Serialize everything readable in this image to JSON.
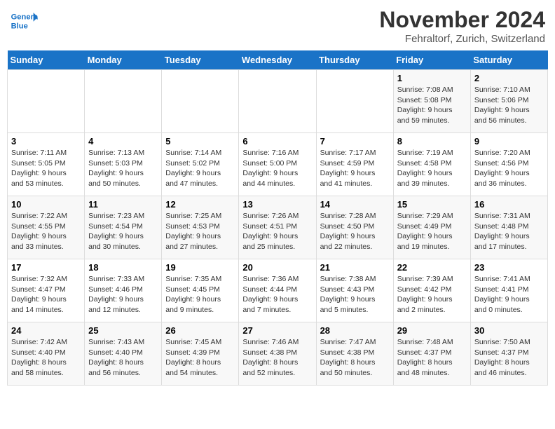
{
  "header": {
    "logo_line1": "General",
    "logo_line2": "Blue",
    "main_title": "November 2024",
    "subtitle": "Fehraltorf, Zurich, Switzerland"
  },
  "days_of_week": [
    "Sunday",
    "Monday",
    "Tuesday",
    "Wednesday",
    "Thursday",
    "Friday",
    "Saturday"
  ],
  "weeks": [
    [
      {
        "day": "",
        "info": ""
      },
      {
        "day": "",
        "info": ""
      },
      {
        "day": "",
        "info": ""
      },
      {
        "day": "",
        "info": ""
      },
      {
        "day": "",
        "info": ""
      },
      {
        "day": "1",
        "info": "Sunrise: 7:08 AM\nSunset: 5:08 PM\nDaylight: 9 hours and 59 minutes."
      },
      {
        "day": "2",
        "info": "Sunrise: 7:10 AM\nSunset: 5:06 PM\nDaylight: 9 hours and 56 minutes."
      }
    ],
    [
      {
        "day": "3",
        "info": "Sunrise: 7:11 AM\nSunset: 5:05 PM\nDaylight: 9 hours and 53 minutes."
      },
      {
        "day": "4",
        "info": "Sunrise: 7:13 AM\nSunset: 5:03 PM\nDaylight: 9 hours and 50 minutes."
      },
      {
        "day": "5",
        "info": "Sunrise: 7:14 AM\nSunset: 5:02 PM\nDaylight: 9 hours and 47 minutes."
      },
      {
        "day": "6",
        "info": "Sunrise: 7:16 AM\nSunset: 5:00 PM\nDaylight: 9 hours and 44 minutes."
      },
      {
        "day": "7",
        "info": "Sunrise: 7:17 AM\nSunset: 4:59 PM\nDaylight: 9 hours and 41 minutes."
      },
      {
        "day": "8",
        "info": "Sunrise: 7:19 AM\nSunset: 4:58 PM\nDaylight: 9 hours and 39 minutes."
      },
      {
        "day": "9",
        "info": "Sunrise: 7:20 AM\nSunset: 4:56 PM\nDaylight: 9 hours and 36 minutes."
      }
    ],
    [
      {
        "day": "10",
        "info": "Sunrise: 7:22 AM\nSunset: 4:55 PM\nDaylight: 9 hours and 33 minutes."
      },
      {
        "day": "11",
        "info": "Sunrise: 7:23 AM\nSunset: 4:54 PM\nDaylight: 9 hours and 30 minutes."
      },
      {
        "day": "12",
        "info": "Sunrise: 7:25 AM\nSunset: 4:53 PM\nDaylight: 9 hours and 27 minutes."
      },
      {
        "day": "13",
        "info": "Sunrise: 7:26 AM\nSunset: 4:51 PM\nDaylight: 9 hours and 25 minutes."
      },
      {
        "day": "14",
        "info": "Sunrise: 7:28 AM\nSunset: 4:50 PM\nDaylight: 9 hours and 22 minutes."
      },
      {
        "day": "15",
        "info": "Sunrise: 7:29 AM\nSunset: 4:49 PM\nDaylight: 9 hours and 19 minutes."
      },
      {
        "day": "16",
        "info": "Sunrise: 7:31 AM\nSunset: 4:48 PM\nDaylight: 9 hours and 17 minutes."
      }
    ],
    [
      {
        "day": "17",
        "info": "Sunrise: 7:32 AM\nSunset: 4:47 PM\nDaylight: 9 hours and 14 minutes."
      },
      {
        "day": "18",
        "info": "Sunrise: 7:33 AM\nSunset: 4:46 PM\nDaylight: 9 hours and 12 minutes."
      },
      {
        "day": "19",
        "info": "Sunrise: 7:35 AM\nSunset: 4:45 PM\nDaylight: 9 hours and 9 minutes."
      },
      {
        "day": "20",
        "info": "Sunrise: 7:36 AM\nSunset: 4:44 PM\nDaylight: 9 hours and 7 minutes."
      },
      {
        "day": "21",
        "info": "Sunrise: 7:38 AM\nSunset: 4:43 PM\nDaylight: 9 hours and 5 minutes."
      },
      {
        "day": "22",
        "info": "Sunrise: 7:39 AM\nSunset: 4:42 PM\nDaylight: 9 hours and 2 minutes."
      },
      {
        "day": "23",
        "info": "Sunrise: 7:41 AM\nSunset: 4:41 PM\nDaylight: 9 hours and 0 minutes."
      }
    ],
    [
      {
        "day": "24",
        "info": "Sunrise: 7:42 AM\nSunset: 4:40 PM\nDaylight: 8 hours and 58 minutes."
      },
      {
        "day": "25",
        "info": "Sunrise: 7:43 AM\nSunset: 4:40 PM\nDaylight: 8 hours and 56 minutes."
      },
      {
        "day": "26",
        "info": "Sunrise: 7:45 AM\nSunset: 4:39 PM\nDaylight: 8 hours and 54 minutes."
      },
      {
        "day": "27",
        "info": "Sunrise: 7:46 AM\nSunset: 4:38 PM\nDaylight: 8 hours and 52 minutes."
      },
      {
        "day": "28",
        "info": "Sunrise: 7:47 AM\nSunset: 4:38 PM\nDaylight: 8 hours and 50 minutes."
      },
      {
        "day": "29",
        "info": "Sunrise: 7:48 AM\nSunset: 4:37 PM\nDaylight: 8 hours and 48 minutes."
      },
      {
        "day": "30",
        "info": "Sunrise: 7:50 AM\nSunset: 4:37 PM\nDaylight: 8 hours and 46 minutes."
      }
    ]
  ]
}
